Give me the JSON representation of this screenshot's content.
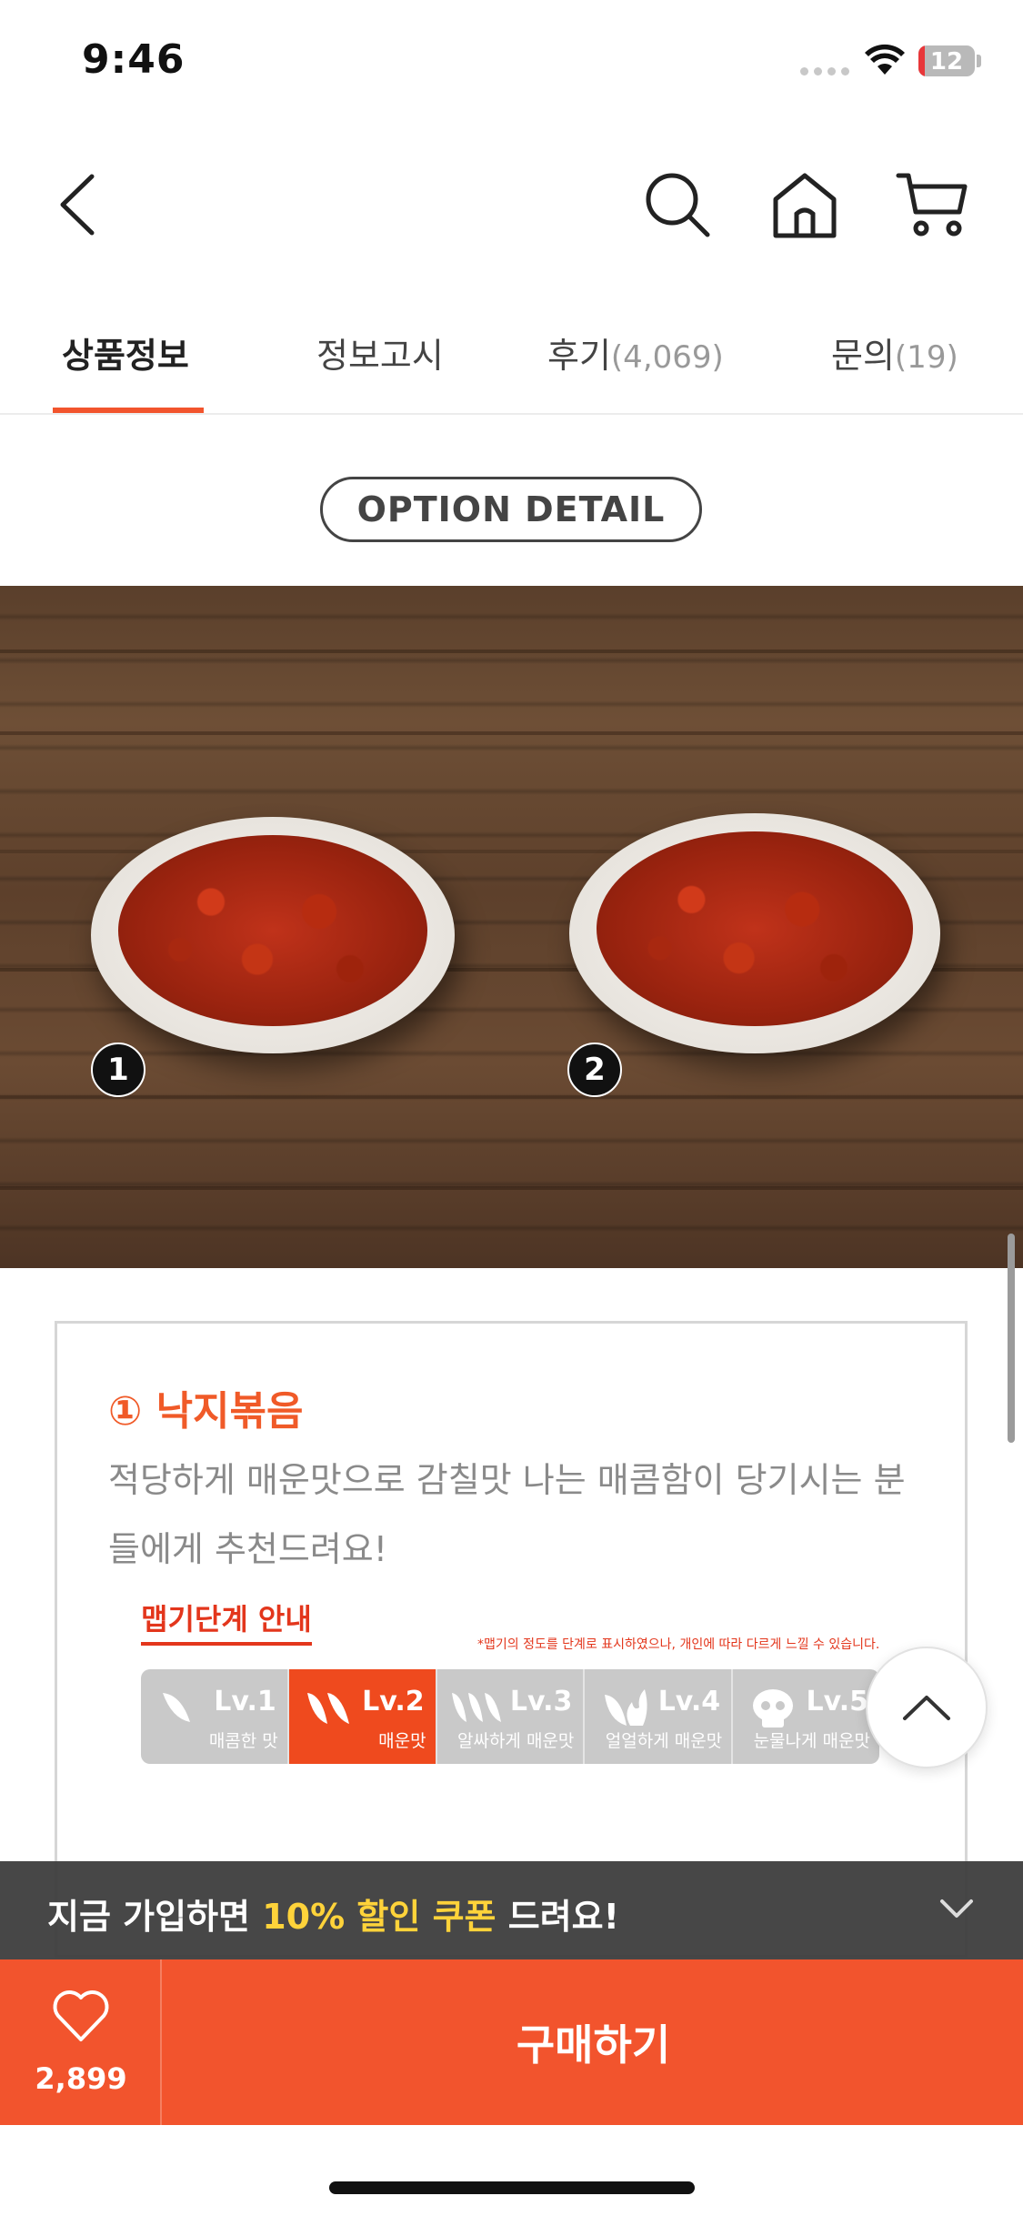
{
  "status_bar": {
    "time": "9:46",
    "battery": "12"
  },
  "tabs": [
    {
      "label": "상품정보",
      "count": ""
    },
    {
      "label": "정보고시",
      "count": ""
    },
    {
      "label": "후기",
      "count": "(4,069)"
    },
    {
      "label": "문의",
      "count": "(19)"
    }
  ],
  "option_detail": {
    "label": "OPTION DETAIL"
  },
  "photo": {
    "badge1": "1",
    "badge2": "2"
  },
  "info": {
    "title": "① 낙지볶음",
    "description": "적당하게 매운맛으로 감칠맛 나는 매콤함이 당기시는 분들에게 추천드려요!",
    "spice_title": "맵기단계 안내",
    "spice_note": "*맵기의 정도를 단계로 표시하였으나, 개인에 따라 다르게 느낄 수 있습니다.",
    "active_level": 2,
    "levels": [
      {
        "lv": "Lv.1",
        "desc": "매콤한 맛"
      },
      {
        "lv": "Lv.2",
        "desc": "매운맛"
      },
      {
        "lv": "Lv.3",
        "desc": "알싸하게 매운맛"
      },
      {
        "lv": "Lv.4",
        "desc": "얼얼하게 매운맛"
      },
      {
        "lv": "Lv.5",
        "desc": "눈물나게 매운맛"
      }
    ]
  },
  "promo": {
    "text_1": "지금 가입하면 ",
    "highlight_1": "10% 할인 쿠폰",
    "text_2": " 드려요!"
  },
  "bottom": {
    "like_count": "2,899",
    "buy_label": "구매하기"
  },
  "colors": {
    "accent": "#f2542d",
    "highlight": "#ffd33a",
    "spice_red": "#e3361c"
  }
}
